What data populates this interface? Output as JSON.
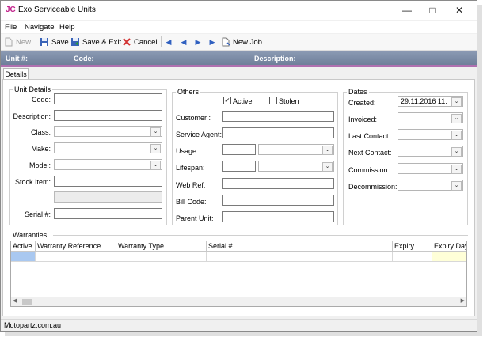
{
  "window": {
    "logo": "JC",
    "title": "Exo Serviceable Units"
  },
  "menu": [
    "File",
    "Navigate",
    "Help"
  ],
  "toolbar": {
    "new_label": "New",
    "save_label": "Save",
    "save_exit_label": "Save & Exit",
    "cancel_label": "Cancel",
    "new_job_label": "New Job"
  },
  "header": {
    "unit_label": "Unit #:",
    "code_label": "Code:",
    "description_label": "Description:"
  },
  "tabs": [
    "Details"
  ],
  "unit_details": {
    "title": "Unit Details",
    "code": "Code:",
    "description": "Description:",
    "class": "Class:",
    "make": "Make:",
    "model": "Model:",
    "stock_item": "Stock Item:",
    "serial": "Serial #:"
  },
  "others": {
    "title": "Others",
    "active": "Active",
    "active_checked": true,
    "stolen": "Stolen",
    "stolen_checked": false,
    "customer": "Customer :",
    "service_agent": "Service Agent:",
    "usage": "Usage:",
    "lifespan": "Lifespan:",
    "web_ref": "Web Ref:",
    "bill_code": "Bill Code:",
    "parent_unit": "Parent Unit:"
  },
  "dates": {
    "title": "Dates",
    "created": "Created:",
    "created_value": "29.11.2016 11:",
    "invoiced": "Invoiced:",
    "last_contact": "Last Contact:",
    "next_contact": "Next Contact:",
    "commission": "Commission:",
    "decommission": "Decommission:"
  },
  "warranties": {
    "title": "Warranties",
    "columns": [
      "Active",
      "Warranty Reference",
      "Warranty Type",
      "Serial #",
      "Expiry",
      "Expiry Days"
    ]
  },
  "status": {
    "text": "Motopartz.com.au"
  },
  "colors": {
    "header_bg": "#7b8aa6",
    "header_accent": "#b070b0",
    "logo": "#c0208a",
    "active_cell": "#a9c8f0",
    "expiry_days_cell": "#ffffd8"
  }
}
